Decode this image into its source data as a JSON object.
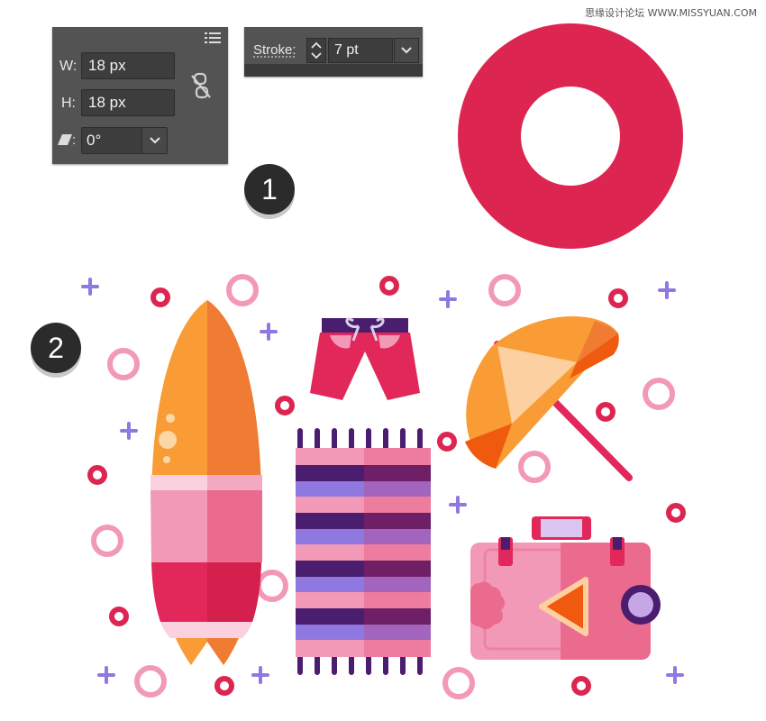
{
  "watermark": "思缘设计论坛 WWW.MISSYUAN.COM",
  "transform_panel": {
    "width_label": "W:",
    "width_value": "18 px",
    "height_label": "H:",
    "height_value": "18 px",
    "shear_label": ":",
    "shear_value": "0°",
    "menu_icon": "panel-menu-icon",
    "constrain_icon": "unlink-proportions-icon"
  },
  "stroke_panel": {
    "label": "Stroke:",
    "weight_value": "7 pt"
  },
  "badges": {
    "step1": "1",
    "step2": "2"
  },
  "colors": {
    "ring": "#dc2651",
    "orange": "#f99c35",
    "orange_dark": "#f07c34",
    "pink": "#f399b8",
    "pink_dark": "#ea6b8e",
    "purple": "#4a1d6e",
    "lavender": "#8f78e0",
    "panel_bg": "#535353"
  },
  "illustration": {
    "items": [
      "donut-ring",
      "surfboard",
      "swim-shorts",
      "beach-towel",
      "beach-umbrella",
      "suitcase"
    ]
  }
}
